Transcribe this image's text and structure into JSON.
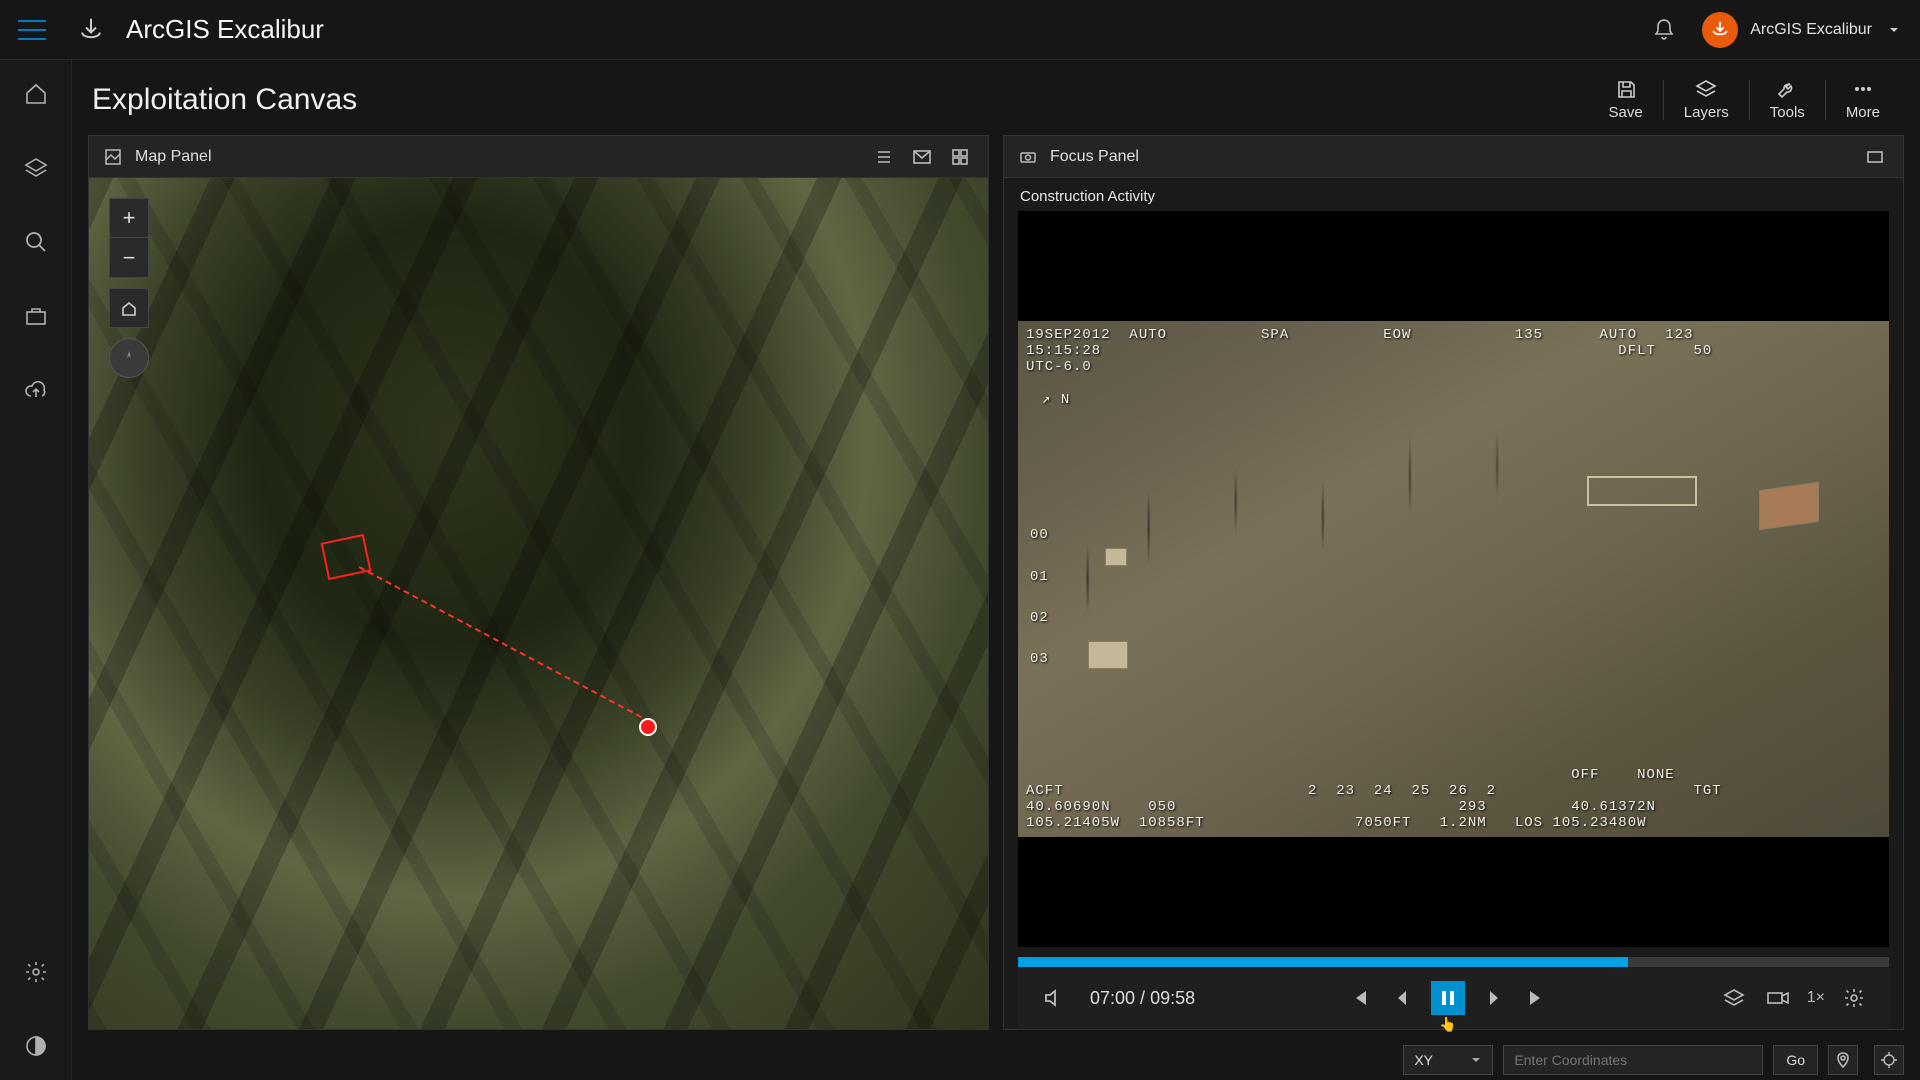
{
  "app": {
    "title": "ArcGIS Excalibur",
    "user_label": "ArcGIS Excalibur"
  },
  "page": {
    "title": "Exploitation Canvas"
  },
  "toolbar": {
    "save": "Save",
    "layers": "Layers",
    "tools": "Tools",
    "more": "More"
  },
  "mapPanel": {
    "title": "Map Panel"
  },
  "focusPanel": {
    "title": "Focus Panel",
    "clip_title": "Construction Activity",
    "time_current": "07:00",
    "time_total": "09:58",
    "speed": "1×",
    "progress_pct": 70,
    "hud": {
      "tl1": "19SEP2012  AUTO          SPA          EOW           135      AUTO   123",
      "tl2": "15:15:28",
      "tl3": "UTC-6.0",
      "tl4": "                                                               DFLT    50",
      "compass": "↗ N",
      "left_scale": [
        "00",
        "01",
        "02",
        "03"
      ],
      "br1": "                                                          OFF    NONE",
      "br2": "ACFT                          2  23  24  25  26  2                     TGT",
      "br3": "40.60690N    050                              293         40.61372N",
      "br4": "105.21405W  10858FT                7050FT   1.2NM   LOS 105.23480W"
    }
  },
  "footer": {
    "mode": "XY",
    "placeholder": "Enter Coordinates",
    "go": "Go"
  }
}
